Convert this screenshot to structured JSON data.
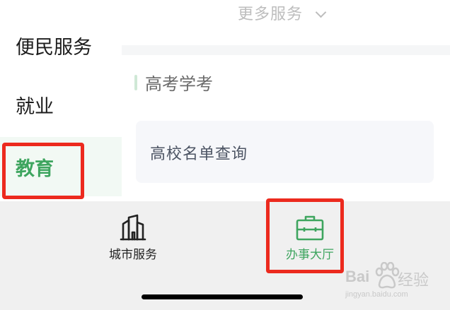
{
  "main": {
    "more_services_label": "更多服务",
    "section_title": "高考学考",
    "card_label": "高校名单查询"
  },
  "sidebar": {
    "items": [
      {
        "label": "便民服务",
        "active": false
      },
      {
        "label": "就业",
        "active": false
      },
      {
        "label": "教育",
        "active": true
      }
    ]
  },
  "tabbar": {
    "tabs": [
      {
        "label": "城市服务",
        "icon": "city-buildings-icon",
        "active": false
      },
      {
        "label": "办事大厅",
        "icon": "briefcase-icon",
        "active": true
      }
    ]
  },
  "watermark": {
    "brand_latin": "Bai",
    "brand_cn": "经验",
    "url": "jingyan.baidu.com"
  },
  "colors": {
    "accent_green": "#3ea55f",
    "highlight_red": "#ec2a1e",
    "active_item_bg": "#f2f9f4"
  }
}
